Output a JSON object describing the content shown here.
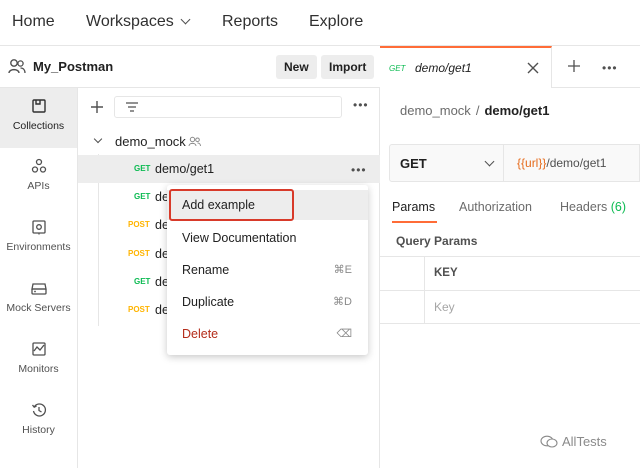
{
  "topnav": {
    "home": "Home",
    "workspaces": "Workspaces",
    "reports": "Reports",
    "explore": "Explore"
  },
  "workspace": {
    "name": "My_Postman",
    "new_label": "New",
    "import_label": "Import"
  },
  "rail": {
    "items": [
      {
        "label": "Collections",
        "icon": "collections-icon",
        "active": true
      },
      {
        "label": "APIs",
        "icon": "apis-icon"
      },
      {
        "label": "Environments",
        "icon": "environments-icon"
      },
      {
        "label": "Mock Servers",
        "icon": "mock-servers-icon"
      },
      {
        "label": "Monitors",
        "icon": "monitors-icon"
      },
      {
        "label": "History",
        "icon": "history-icon"
      }
    ]
  },
  "tree": {
    "collection": "demo_mock",
    "requests": [
      {
        "method": "GET",
        "name": "demo/get1"
      },
      {
        "method": "GET",
        "name": "de"
      },
      {
        "method": "POST",
        "name": "de"
      },
      {
        "method": "POST",
        "name": "de"
      },
      {
        "method": "GET",
        "name": "de"
      },
      {
        "method": "POST",
        "name": "de"
      }
    ]
  },
  "context_menu": {
    "items": [
      {
        "label": "Add example",
        "shortcut": ""
      },
      {
        "label": "View Documentation",
        "shortcut": ""
      },
      {
        "label": "Rename",
        "shortcut": "⌘E"
      },
      {
        "label": "Duplicate",
        "shortcut": "⌘D"
      },
      {
        "label": "Delete",
        "shortcut": "⌫"
      }
    ]
  },
  "tab": {
    "method": "GET",
    "name": "demo/get1"
  },
  "breadcrumb": {
    "parent": "demo_mock",
    "separator": "/",
    "current": "demo/get1"
  },
  "request": {
    "method": "GET",
    "url_var": "{{url}}",
    "url_path": "/demo/get1",
    "tabs": {
      "params": "Params",
      "authorization": "Authorization",
      "headers": "Headers",
      "headers_count": "(6)"
    },
    "query_params_title": "Query Params",
    "key_header": "KEY",
    "key_placeholder": "Key"
  },
  "watermark": "AllTests",
  "colors": {
    "accent": "#ff6c37",
    "get": "#0cbb52",
    "post": "#ffb400",
    "danger": "#b42c1a",
    "highlight": "#d83a2a"
  }
}
